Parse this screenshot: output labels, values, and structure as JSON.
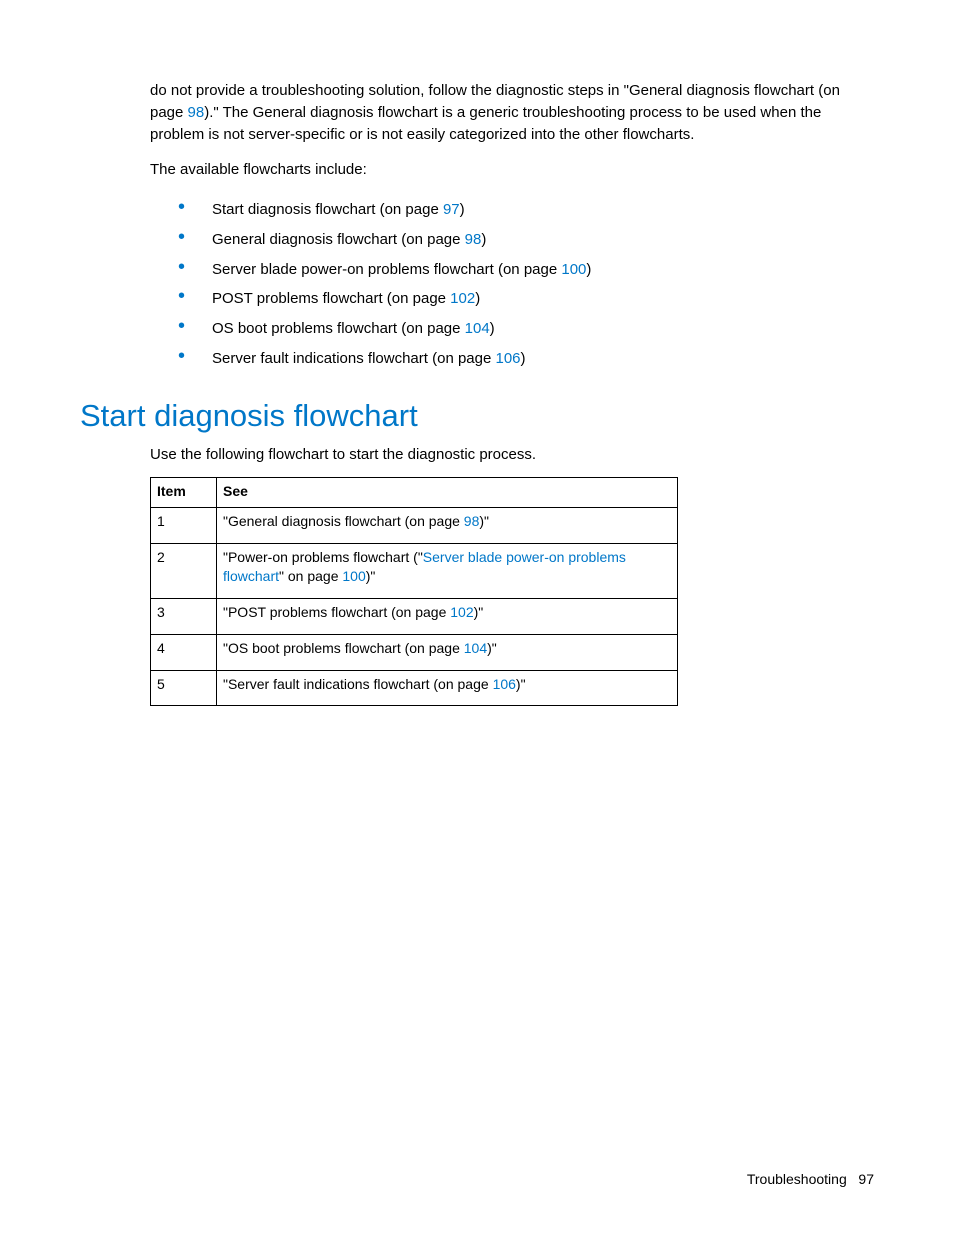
{
  "intro": {
    "p1_a": "do not provide a troubleshooting solution, follow the diagnostic steps in \"General diagnosis flowchart (on page ",
    "p1_link": "98",
    "p1_b": ").\" The General diagnosis flowchart is a generic troubleshooting process to be used when the problem is not server-specific or is not easily categorized into the other flowcharts.",
    "p2": "The available flowcharts include:"
  },
  "bullets": [
    {
      "pre": "Start diagnosis flowchart (on page ",
      "link": "97",
      "post": ")"
    },
    {
      "pre": "General diagnosis flowchart (on page ",
      "link": "98",
      "post": ")"
    },
    {
      "pre": "Server blade power-on problems flowchart (on page ",
      "link": "100",
      "post": ")"
    },
    {
      "pre": "POST problems flowchart (on page ",
      "link": "102",
      "post": ")"
    },
    {
      "pre": "OS boot problems flowchart (on page ",
      "link": "104",
      "post": ")"
    },
    {
      "pre": "Server fault indications flowchart (on page ",
      "link": "106",
      "post": ")"
    }
  ],
  "heading": "Start diagnosis flowchart",
  "table_intro": "Use the following flowchart to start the diagnostic process.",
  "table": {
    "head_item": "Item",
    "head_see": "See",
    "rows": [
      {
        "item": "1",
        "pre": "\"General diagnosis flowchart (on page ",
        "link": "98",
        "post": ")\""
      },
      {
        "item": "2",
        "pre": "\"Power-on problems flowchart (\"",
        "link": "Server blade power-on problems flowchart",
        "mid": "\" on page ",
        "link2": "100",
        "post": ")\""
      },
      {
        "item": "3",
        "pre": "\"POST problems flowchart (on page ",
        "link": "102",
        "post": ")\""
      },
      {
        "item": "4",
        "pre": "\"OS boot problems flowchart (on page ",
        "link": "104",
        "post": ")\""
      },
      {
        "item": "5",
        "pre": "\"Server fault indications flowchart (on page ",
        "link": "106",
        "post": ")\""
      }
    ]
  },
  "footer": {
    "section": "Troubleshooting",
    "page": "97"
  }
}
